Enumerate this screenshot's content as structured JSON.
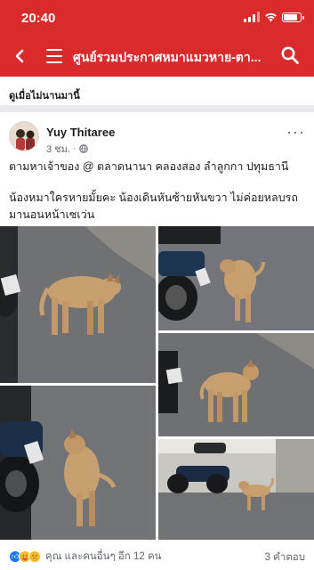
{
  "status_bar": {
    "time": "20:40",
    "battery_level": 0.85
  },
  "nav": {
    "title": "ศูนย์รวมประกาศหมาแมวหาย-ตา...",
    "back_icon": "chevron-left-icon",
    "menu_icon": "hamburger-menu-icon",
    "search_icon": "search-icon"
  },
  "feed": {
    "section_label": "ดูเมื่อไม่นานมานี้"
  },
  "post": {
    "author": "Yuy Thitaree",
    "time": "3 ชม.",
    "separator": "·",
    "privacy_icon": "globe-icon",
    "more": "···",
    "text_line_1": "ตามหาเจ้าของ @ ตลาดนานา คลองสอง ลำลูกกา ปทุมธานี",
    "text_line_2": "น้องหมาใครหายมั้ยคะ น้องเดินหันซ้ายหันขวา ไม่ค่อยหลบรถ",
    "text_line_3": "มานอนหน้าเซเว่น",
    "photo_count": 5
  },
  "footer": {
    "reaction_icons": [
      "like-icon",
      "care-icon",
      "sad-icon"
    ],
    "reactions_text": "คุณ และคนอื่นๆ อีก 12 คน",
    "comments_text": "3 คำตอบ"
  },
  "colors": {
    "brand_red": "#d92b2b",
    "asphalt": "#6b6d70",
    "dog_tan": "#c8a070",
    "text_secondary": "#606770"
  }
}
